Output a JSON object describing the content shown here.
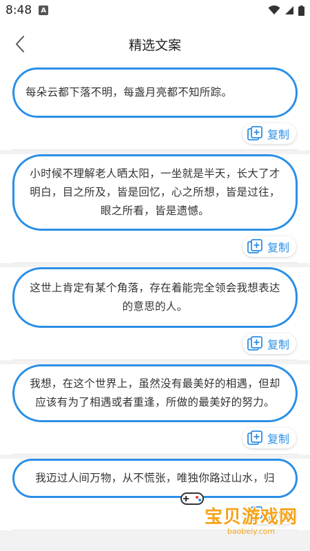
{
  "status_bar": {
    "time": "8:48",
    "notification_letter": "A"
  },
  "header": {
    "title": "精选文案"
  },
  "quotes": [
    {
      "text": "每朵云都下落不明，每盏月亮都不知所踪。",
      "copy_label": "复制"
    },
    {
      "text": "小时候不理解老人晒太阳，一坐就是半天，长大了才明白，目之所及，皆是回忆，心之所想，皆是过往，眼之所看，皆是遗憾。",
      "copy_label": "复制"
    },
    {
      "text": "这世上肯定有某个角落，存在着能完全领会我想表达的意思的人。",
      "copy_label": "复制"
    },
    {
      "text": "我想，在这个世界上，虽然没有最美好的相遇，但却应该有为了相遇或者重逢，所做的最美好的努力。",
      "copy_label": "复制"
    },
    {
      "text": "我迈过人间万物，从不慌张，唯独你路过山水，归",
      "copy_label": "复制"
    }
  ],
  "watermark": {
    "main": "宝贝游戏网",
    "sub": "baobeiy.com"
  },
  "colors": {
    "accent": "#2a8fe6",
    "watermark": "#f5a31a",
    "background": "#f2f2f2"
  }
}
